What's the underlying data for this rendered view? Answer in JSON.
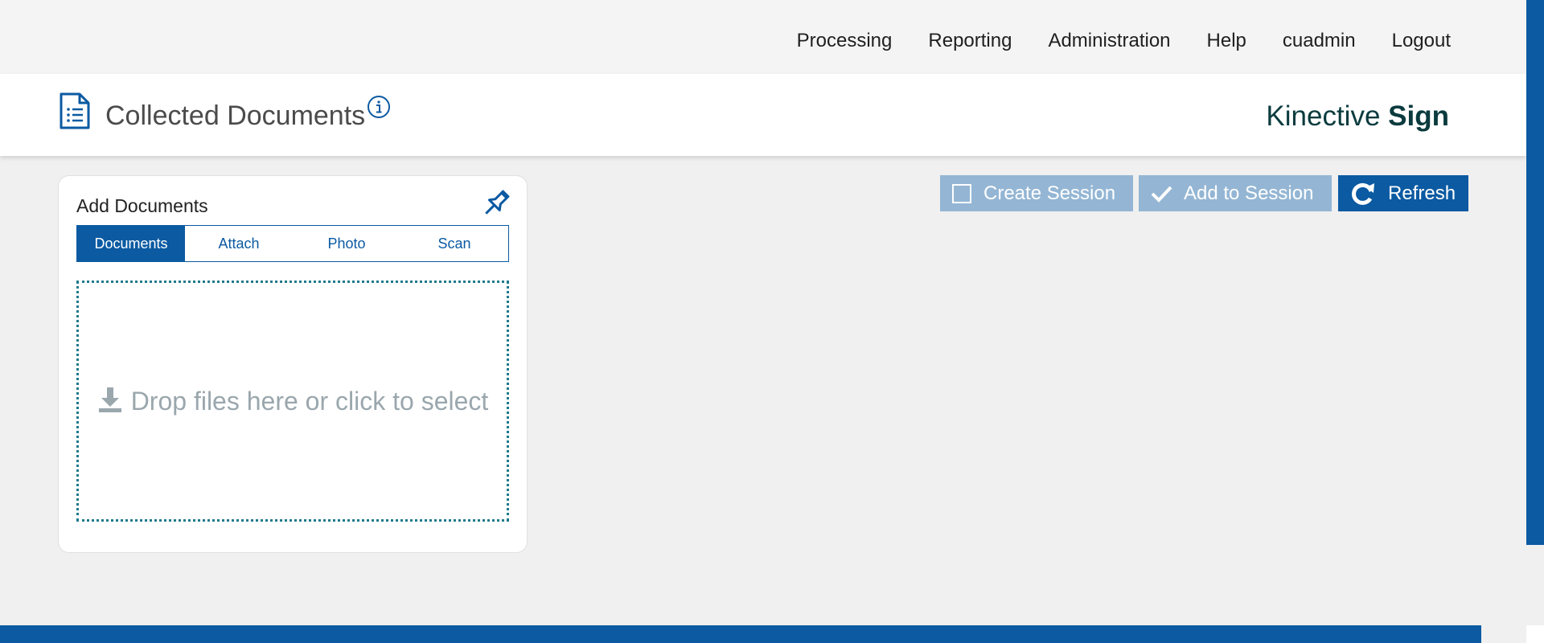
{
  "nav": {
    "items": [
      "Processing",
      "Reporting",
      "Administration",
      "Help",
      "cuadmin",
      "Logout"
    ]
  },
  "header": {
    "title": "Collected Documents",
    "brand_light": "Kinective",
    "brand_bold": "Sign"
  },
  "panel": {
    "title": "Add Documents",
    "tabs": [
      "Documents",
      "Attach",
      "Photo",
      "Scan"
    ],
    "active_tab": "Documents",
    "drop_text": "Drop files here or click to select"
  },
  "actions": {
    "create_session": "Create Session",
    "add_to_session": "Add to Session",
    "refresh": "Refresh"
  },
  "colors": {
    "primary": "#0b5aa2",
    "disabled_button": "#94b6d4",
    "brand_text": "#0b3b3e",
    "dropzone_border": "#1f7a8c"
  },
  "icons": {
    "title": "document-list-icon",
    "info": "info-icon",
    "pin": "pin-icon",
    "drop": "download-icon",
    "create": "square-icon",
    "add": "checkmark-icon",
    "refresh": "refresh-icon"
  }
}
